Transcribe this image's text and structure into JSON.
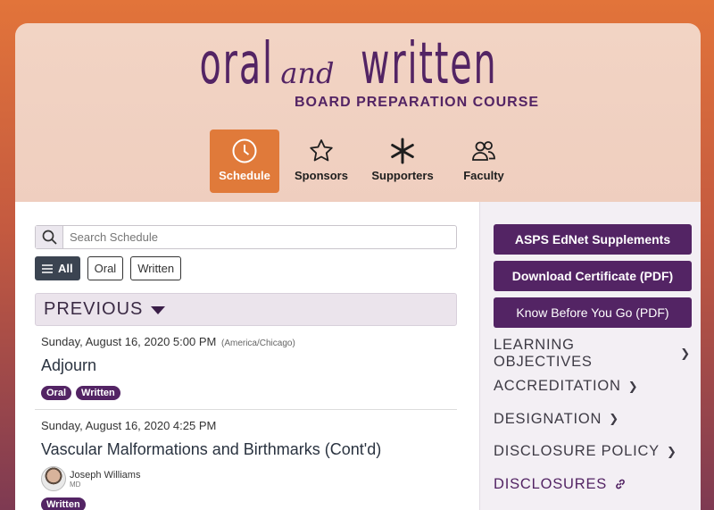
{
  "logo": {
    "word1": "oral",
    "and": "and",
    "word2": "written",
    "subtitle": "BOARD PREPARATION COURSE"
  },
  "nav": [
    {
      "label": "Schedule",
      "icon": "clock-icon",
      "active": true
    },
    {
      "label": "Sponsors",
      "icon": "star-icon",
      "active": false
    },
    {
      "label": "Supporters",
      "icon": "asterisk-icon",
      "active": false
    },
    {
      "label": "Faculty",
      "icon": "people-icon",
      "active": false
    }
  ],
  "search": {
    "placeholder": "Search Schedule",
    "value": ""
  },
  "filters": [
    {
      "label": "All",
      "active": true
    },
    {
      "label": "Oral",
      "active": false
    },
    {
      "label": "Written",
      "active": false
    }
  ],
  "section": {
    "title": "PREVIOUS"
  },
  "sessions": [
    {
      "time": "Sunday, August 16, 2020 5:00 PM",
      "timezone": "(America/Chicago)",
      "title": "Adjourn",
      "tags": [
        "Oral",
        "Written"
      ]
    },
    {
      "time": "Sunday, August 16, 2020 4:25 PM",
      "title": "Vascular Malformations and Birthmarks (Cont'd)",
      "speaker": {
        "name": "Joseph Williams",
        "credential": "MD"
      },
      "tags": [
        "Written"
      ]
    }
  ],
  "sidebar": {
    "buttons": [
      "ASPS EdNet Supplements",
      "Download Certificate (PDF)",
      "Know Before You Go (PDF)"
    ],
    "links": [
      "LEARNING OBJECTIVES",
      "ACCREDITATION",
      "DESIGNATION",
      "DISCLOSURE POLICY",
      "DISCLOSURES"
    ]
  },
  "colors": {
    "brand": "#532464",
    "accent": "#e07a3a",
    "filter_active": "#3b4451"
  }
}
